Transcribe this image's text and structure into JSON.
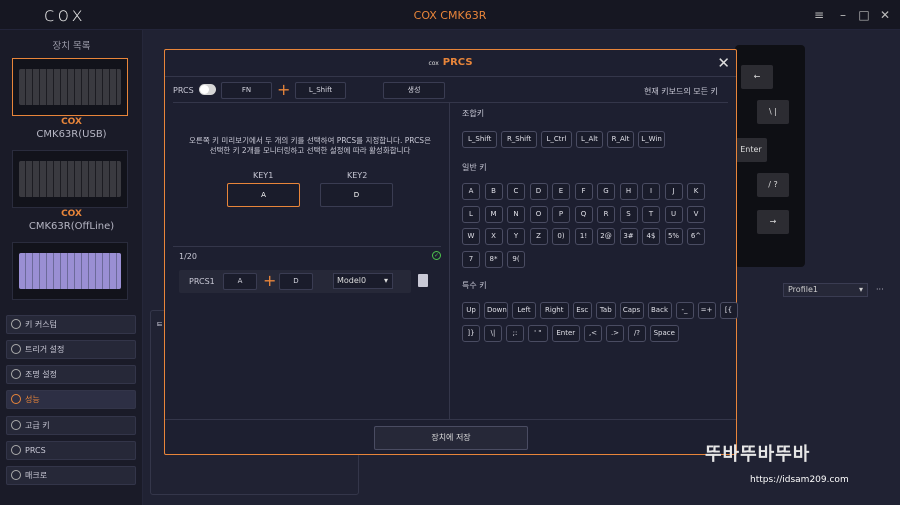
{
  "app": {
    "logo": "cox",
    "title": "COX CMK63R",
    "min": "–",
    "max": "□",
    "close": "✕",
    "menu": "≡"
  },
  "sidebar": {
    "header": "장치 목록",
    "devices": [
      {
        "brand": "COX",
        "name": "CMK63R(USB)"
      },
      {
        "brand": "COX",
        "name": "CMK63R(OffLine)"
      }
    ],
    "menu": [
      {
        "label": "키 커스텀",
        "icon": "key-icon"
      },
      {
        "label": "트리거 설정",
        "icon": "trigger-icon"
      },
      {
        "label": "조명 설정",
        "icon": "light-icon"
      },
      {
        "label": "성능",
        "icon": "performance-icon"
      },
      {
        "label": "고급 키",
        "icon": "advanced-key-icon"
      },
      {
        "label": "PRCS",
        "icon": "prcs-icon"
      },
      {
        "label": "매크로",
        "icon": "macro-icon"
      }
    ]
  },
  "background": {
    "profile": "Profile1",
    "more": "···",
    "keys": [
      "←",
      "\\ |",
      "Enter",
      "/ ?",
      "→"
    ],
    "panel_char": "ㅌ"
  },
  "modal": {
    "brand": "cox",
    "title": "PRCS",
    "close": "✕",
    "prcs_label": "PRCS",
    "fn": "FN",
    "plus": "+",
    "lshift": "L_Shift",
    "generate": "생성",
    "all_keys": "현재 키보드의 모든 키",
    "instruction": "오른쪽 키 미리보기에서 두 개의 키를 선택하여 PRCS를 지정합니다. PRCS은 선택한 키 2개를 모니터링하고 선택한 설정에 따라 활성화합니다",
    "key1_label": "KEY1",
    "key1_value": "A",
    "key2_label": "KEY2",
    "key2_value": "D",
    "count": "1/20",
    "row": {
      "name": "PRCS1",
      "key1": "A",
      "plus": "+",
      "key2": "D",
      "mode": "Model0"
    },
    "combo_title": "조합키",
    "combo_keys": [
      "L_Shift",
      "R_Shift",
      "L_Ctrl",
      "L_Alt",
      "R_Alt",
      "L_Win"
    ],
    "normal_title": "일반 키",
    "normal_keys": [
      [
        "A",
        "B",
        "C",
        "D",
        "E",
        "F",
        "G",
        "H",
        "I",
        "J",
        "K"
      ],
      [
        "L",
        "M",
        "N",
        "O",
        "P",
        "Q",
        "R",
        "S",
        "T",
        "U",
        "V"
      ],
      [
        "W",
        "X",
        "Y",
        "Z",
        "0)",
        "1!",
        "2@",
        "3#",
        "4$",
        "5%",
        "6^"
      ],
      [
        "7",
        "8*",
        "9("
      ]
    ],
    "special_title": "특수 키",
    "special_keys": [
      [
        "Up",
        "Down",
        "Left",
        "Right",
        "Esc",
        "Tab",
        "Caps",
        "Back",
        "-_",
        "=+",
        "[{"
      ],
      [
        "]}",
        "\\|",
        ";:",
        "' \"",
        "Enter",
        ",<",
        ".>",
        "/?",
        "Space"
      ]
    ],
    "save": "장치에 저장"
  },
  "watermark": {
    "text": "뚜바뚜바뚜바",
    "url": "https://idsam209.com"
  }
}
